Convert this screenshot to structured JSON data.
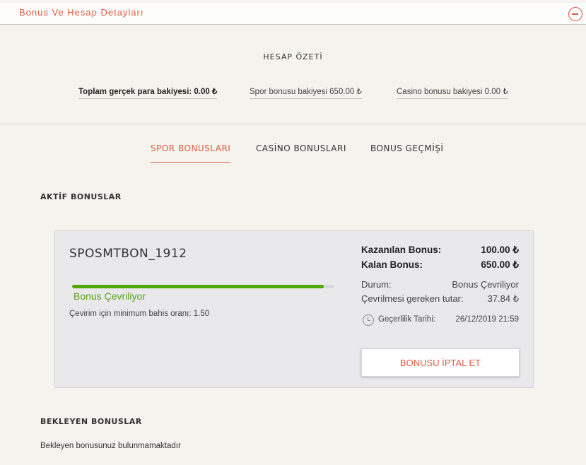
{
  "header": {
    "title": "Bonus Ve Hesap Detayları",
    "collapse_icon": "minus-circle-icon"
  },
  "summary": {
    "title": "HESAP ÖZETİ",
    "real_balance": "Toplam gerçek para bakiyesi: 0.00 ₺",
    "sport_bonus_balance": "Spor bonusu bakiyesi 650.00 ₺",
    "casino_bonus_balance": "Casino bonusu bakiyesi 0.00 ₺"
  },
  "tabs": [
    {
      "label": "SPOR BONUSLARI",
      "active": true
    },
    {
      "label": "CASİNO BONUSLARI",
      "active": false
    },
    {
      "label": "BONUS GEÇMİŞİ",
      "active": false
    }
  ],
  "active_bonuses": {
    "heading": "AKTİF BONUSLAR",
    "card": {
      "name": "SPOSMTBON_1912",
      "progress_fraction": 0.96,
      "progress_label": "Bonus Çevriliyor",
      "min_bet_ratio": "Çevirim için minimum bahis oranı: 1.50",
      "earned_label": "Kazanılan Bonus:",
      "earned_value": "100.00 ₺",
      "remaining_label": "Kalan Bonus:",
      "remaining_value": "650.00 ₺",
      "status_label": "Durum:",
      "status_value": "Bonus Çevriliyor",
      "wager_label": "Çevrilmesi gereken tutar:",
      "wager_value": "37.84 ₺",
      "validity_label": "Geçerlilik Tarihi:",
      "validity_value": "26/12/2019 21:59",
      "clock_icon": "clock-icon",
      "cancel_label": "BONUSU İPTAL ET"
    }
  },
  "pending_bonuses": {
    "heading": "BEKLEYEN BONUSLAR",
    "message": "Bekleyen bonusunuz bulunmamaktadır"
  },
  "colors": {
    "accent": "#e25a43",
    "progress": "#52a800",
    "status_text": "#5aa11d"
  }
}
